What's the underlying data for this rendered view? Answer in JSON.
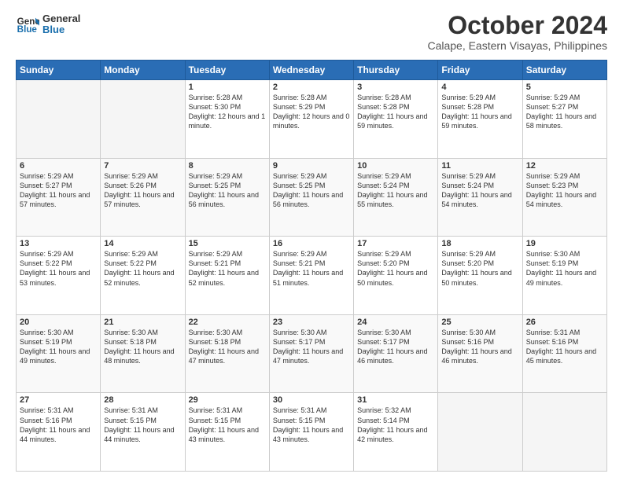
{
  "header": {
    "logo_line1": "General",
    "logo_line2": "Blue",
    "month": "October 2024",
    "location": "Calape, Eastern Visayas, Philippines"
  },
  "weekdays": [
    "Sunday",
    "Monday",
    "Tuesday",
    "Wednesday",
    "Thursday",
    "Friday",
    "Saturday"
  ],
  "weeks": [
    [
      {
        "day": "",
        "sunrise": "",
        "sunset": "",
        "daylight": ""
      },
      {
        "day": "",
        "sunrise": "",
        "sunset": "",
        "daylight": ""
      },
      {
        "day": "1",
        "sunrise": "Sunrise: 5:28 AM",
        "sunset": "Sunset: 5:30 PM",
        "daylight": "Daylight: 12 hours and 1 minute."
      },
      {
        "day": "2",
        "sunrise": "Sunrise: 5:28 AM",
        "sunset": "Sunset: 5:29 PM",
        "daylight": "Daylight: 12 hours and 0 minutes."
      },
      {
        "day": "3",
        "sunrise": "Sunrise: 5:28 AM",
        "sunset": "Sunset: 5:28 PM",
        "daylight": "Daylight: 11 hours and 59 minutes."
      },
      {
        "day": "4",
        "sunrise": "Sunrise: 5:29 AM",
        "sunset": "Sunset: 5:28 PM",
        "daylight": "Daylight: 11 hours and 59 minutes."
      },
      {
        "day": "5",
        "sunrise": "Sunrise: 5:29 AM",
        "sunset": "Sunset: 5:27 PM",
        "daylight": "Daylight: 11 hours and 58 minutes."
      }
    ],
    [
      {
        "day": "6",
        "sunrise": "Sunrise: 5:29 AM",
        "sunset": "Sunset: 5:27 PM",
        "daylight": "Daylight: 11 hours and 57 minutes."
      },
      {
        "day": "7",
        "sunrise": "Sunrise: 5:29 AM",
        "sunset": "Sunset: 5:26 PM",
        "daylight": "Daylight: 11 hours and 57 minutes."
      },
      {
        "day": "8",
        "sunrise": "Sunrise: 5:29 AM",
        "sunset": "Sunset: 5:25 PM",
        "daylight": "Daylight: 11 hours and 56 minutes."
      },
      {
        "day": "9",
        "sunrise": "Sunrise: 5:29 AM",
        "sunset": "Sunset: 5:25 PM",
        "daylight": "Daylight: 11 hours and 56 minutes."
      },
      {
        "day": "10",
        "sunrise": "Sunrise: 5:29 AM",
        "sunset": "Sunset: 5:24 PM",
        "daylight": "Daylight: 11 hours and 55 minutes."
      },
      {
        "day": "11",
        "sunrise": "Sunrise: 5:29 AM",
        "sunset": "Sunset: 5:24 PM",
        "daylight": "Daylight: 11 hours and 54 minutes."
      },
      {
        "day": "12",
        "sunrise": "Sunrise: 5:29 AM",
        "sunset": "Sunset: 5:23 PM",
        "daylight": "Daylight: 11 hours and 54 minutes."
      }
    ],
    [
      {
        "day": "13",
        "sunrise": "Sunrise: 5:29 AM",
        "sunset": "Sunset: 5:22 PM",
        "daylight": "Daylight: 11 hours and 53 minutes."
      },
      {
        "day": "14",
        "sunrise": "Sunrise: 5:29 AM",
        "sunset": "Sunset: 5:22 PM",
        "daylight": "Daylight: 11 hours and 52 minutes."
      },
      {
        "day": "15",
        "sunrise": "Sunrise: 5:29 AM",
        "sunset": "Sunset: 5:21 PM",
        "daylight": "Daylight: 11 hours and 52 minutes."
      },
      {
        "day": "16",
        "sunrise": "Sunrise: 5:29 AM",
        "sunset": "Sunset: 5:21 PM",
        "daylight": "Daylight: 11 hours and 51 minutes."
      },
      {
        "day": "17",
        "sunrise": "Sunrise: 5:29 AM",
        "sunset": "Sunset: 5:20 PM",
        "daylight": "Daylight: 11 hours and 50 minutes."
      },
      {
        "day": "18",
        "sunrise": "Sunrise: 5:29 AM",
        "sunset": "Sunset: 5:20 PM",
        "daylight": "Daylight: 11 hours and 50 minutes."
      },
      {
        "day": "19",
        "sunrise": "Sunrise: 5:30 AM",
        "sunset": "Sunset: 5:19 PM",
        "daylight": "Daylight: 11 hours and 49 minutes."
      }
    ],
    [
      {
        "day": "20",
        "sunrise": "Sunrise: 5:30 AM",
        "sunset": "Sunset: 5:19 PM",
        "daylight": "Daylight: 11 hours and 49 minutes."
      },
      {
        "day": "21",
        "sunrise": "Sunrise: 5:30 AM",
        "sunset": "Sunset: 5:18 PM",
        "daylight": "Daylight: 11 hours and 48 minutes."
      },
      {
        "day": "22",
        "sunrise": "Sunrise: 5:30 AM",
        "sunset": "Sunset: 5:18 PM",
        "daylight": "Daylight: 11 hours and 47 minutes."
      },
      {
        "day": "23",
        "sunrise": "Sunrise: 5:30 AM",
        "sunset": "Sunset: 5:17 PM",
        "daylight": "Daylight: 11 hours and 47 minutes."
      },
      {
        "day": "24",
        "sunrise": "Sunrise: 5:30 AM",
        "sunset": "Sunset: 5:17 PM",
        "daylight": "Daylight: 11 hours and 46 minutes."
      },
      {
        "day": "25",
        "sunrise": "Sunrise: 5:30 AM",
        "sunset": "Sunset: 5:16 PM",
        "daylight": "Daylight: 11 hours and 46 minutes."
      },
      {
        "day": "26",
        "sunrise": "Sunrise: 5:31 AM",
        "sunset": "Sunset: 5:16 PM",
        "daylight": "Daylight: 11 hours and 45 minutes."
      }
    ],
    [
      {
        "day": "27",
        "sunrise": "Sunrise: 5:31 AM",
        "sunset": "Sunset: 5:16 PM",
        "daylight": "Daylight: 11 hours and 44 minutes."
      },
      {
        "day": "28",
        "sunrise": "Sunrise: 5:31 AM",
        "sunset": "Sunset: 5:15 PM",
        "daylight": "Daylight: 11 hours and 44 minutes."
      },
      {
        "day": "29",
        "sunrise": "Sunrise: 5:31 AM",
        "sunset": "Sunset: 5:15 PM",
        "daylight": "Daylight: 11 hours and 43 minutes."
      },
      {
        "day": "30",
        "sunrise": "Sunrise: 5:31 AM",
        "sunset": "Sunset: 5:15 PM",
        "daylight": "Daylight: 11 hours and 43 minutes."
      },
      {
        "day": "31",
        "sunrise": "Sunrise: 5:32 AM",
        "sunset": "Sunset: 5:14 PM",
        "daylight": "Daylight: 11 hours and 42 minutes."
      },
      {
        "day": "",
        "sunrise": "",
        "sunset": "",
        "daylight": ""
      },
      {
        "day": "",
        "sunrise": "",
        "sunset": "",
        "daylight": ""
      }
    ]
  ]
}
